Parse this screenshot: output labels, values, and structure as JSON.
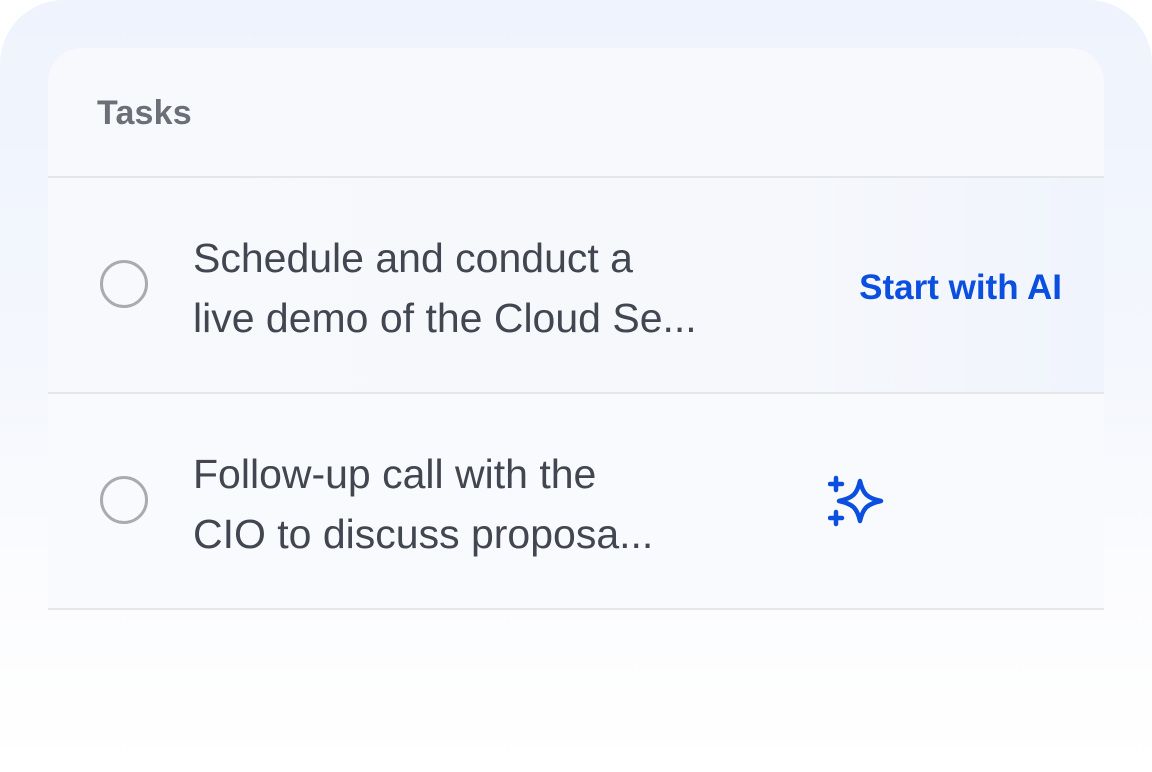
{
  "tasks_card": {
    "title": "Tasks",
    "items": [
      {
        "line1": "Schedule and conduct a",
        "line2": "live demo of the Cloud Se...",
        "action_label": "Start with AI"
      },
      {
        "line1": "Follow-up call with the",
        "line2": "CIO to discuss proposa...",
        "action_icon": "sparkle-icon"
      }
    ]
  },
  "colors": {
    "accent": "#0b4fe0",
    "title_text": "#6b6f78",
    "task_text": "#414651",
    "radio_border": "#a9abb0",
    "divider": "#e4e6ea"
  }
}
